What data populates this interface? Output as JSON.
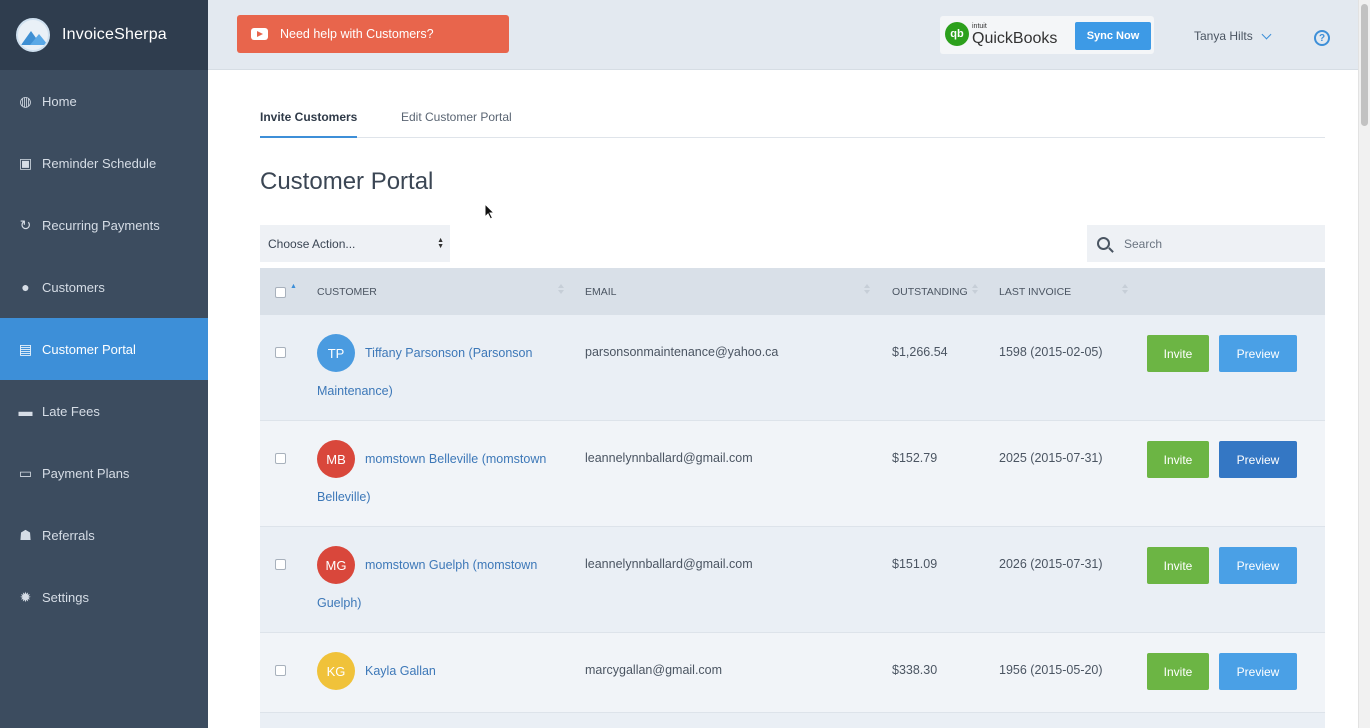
{
  "app": {
    "name": "InvoiceSherpa"
  },
  "sidebar": {
    "items": [
      {
        "label": "Home",
        "icon": "globe-icon",
        "glyph": "◍"
      },
      {
        "label": "Reminder Schedule",
        "icon": "calendar-icon",
        "glyph": "▣"
      },
      {
        "label": "Recurring Payments",
        "icon": "refresh-icon",
        "glyph": "↻"
      },
      {
        "label": "Customers",
        "icon": "user-icon",
        "glyph": "●"
      },
      {
        "label": "Customer Portal",
        "icon": "portal-icon",
        "glyph": "▤",
        "active": true
      },
      {
        "label": "Late Fees",
        "icon": "late-fees-icon",
        "glyph": "▬"
      },
      {
        "label": "Payment Plans",
        "icon": "credit-card-icon",
        "glyph": "▭"
      },
      {
        "label": "Referrals",
        "icon": "user-plus-icon",
        "glyph": "☗"
      },
      {
        "label": "Settings",
        "icon": "gear-icon",
        "glyph": "✹"
      }
    ]
  },
  "topbar": {
    "help_label": "Need help with Customers?",
    "quickbooks": {
      "intuit": "intuit",
      "name": "QuickBooks",
      "logo": "qb"
    },
    "sync_label": "Sync Now",
    "user_name": "Tanya Hilts",
    "help_icon_glyph": "?"
  },
  "tabs": [
    {
      "label": "Invite Customers",
      "active": true
    },
    {
      "label": "Edit Customer Portal",
      "active": false
    }
  ],
  "page_title": "Customer Portal",
  "action_select": {
    "value": "Choose Action..."
  },
  "search": {
    "placeholder": "Search"
  },
  "table": {
    "headers": {
      "customer": "CUSTOMER",
      "email": "EMAIL",
      "outstanding": "OUTSTANDING",
      "last_invoice": "LAST INVOICE"
    },
    "rows": [
      {
        "initials": "TP",
        "avatar_color": "#4a9be0",
        "name": "Tiffany Parsonson (Parsonson Maintenance)",
        "email": "parsonsonmaintenance@yahoo.ca",
        "outstanding": "$1,266.54",
        "last_invoice": "1598 (2015-02-05)",
        "invite": "Invite",
        "preview": "Preview"
      },
      {
        "initials": "MB",
        "avatar_color": "#d9473b",
        "name": "momstown Belleville (momstown Belleville)",
        "email": "leannelynnballard@gmail.com",
        "outstanding": "$152.79",
        "last_invoice": "2025 (2015-07-31)",
        "invite": "Invite",
        "preview": "Preview"
      },
      {
        "initials": "MG",
        "avatar_color": "#d9473b",
        "name": "momstown Guelph (momstown Guelph)",
        "email": "leannelynnballard@gmail.com",
        "outstanding": "$151.09",
        "last_invoice": "2026 (2015-07-31)",
        "invite": "Invite",
        "preview": "Preview"
      },
      {
        "initials": "KG",
        "avatar_color": "#f0c23a",
        "name": "Kayla Gallan",
        "email": "marcygallan@gmail.com",
        "outstanding": "$338.30",
        "last_invoice": "1956 (2015-05-20)",
        "invite": "Invite",
        "preview": "Preview"
      }
    ]
  },
  "colors": {
    "sidebar_bg": "#3c4c5f",
    "active_nav": "#3d8fd8",
    "help_button": "#e8654c",
    "invite_green": "#6cb544",
    "preview_blue": "#4aa0e6"
  }
}
